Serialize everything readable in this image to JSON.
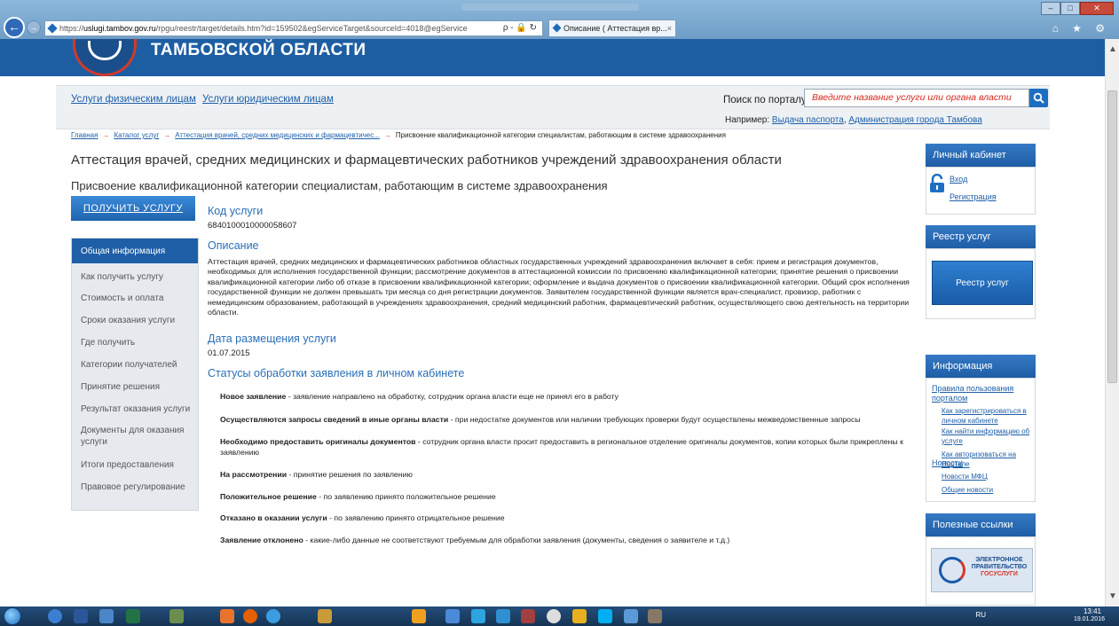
{
  "browser": {
    "address_scheme": "https://",
    "address_host": "uslugi.tambov.gov.ru",
    "address_path": "/rpgu/reestr/target/details.htm?id=159502&egServiceTarget&sourceId=4018@egService",
    "address_icons": "ρ - 🔒 ↻",
    "tab_title": "Описание ( Аттестация вр...",
    "tab_close": "×",
    "chrome_icons": "⌂ ★ ⚙"
  },
  "header": {
    "title": "ТАМБОВСКОЙ ОБЛАСТИ"
  },
  "topnav": {
    "individuals": "Услуги физическим лицам",
    "legal": "Услуги юридическим лицам",
    "search_label": "Поиск по порталу:",
    "search_placeholder": "Введите название услуги или органа власти",
    "example_prefix": "Например:",
    "example_link1": "Выдача паспорта",
    "example_sep": ",",
    "example_link2": "Администрация города Тамбова"
  },
  "breadcrumb": {
    "items": [
      "Главная",
      "Каталог услуг",
      "Аттестация врачей, средних медицинских и фармацевтичес..."
    ],
    "current": "Присвоение квалификационной категории специалистам, работающим в системе здравоохранения",
    "sep": "→"
  },
  "page": {
    "title": "Аттестация врачей, средних медицинских и фармацевтических работников учреждений здравоохранения области",
    "subtitle": "Присвоение квалификационной категории специалистам, работающим в системе здравоохранения",
    "get_service": "ПОЛУЧИТЬ УСЛУГУ"
  },
  "leftnav": {
    "active": "Общая информация",
    "items": [
      "Как получить услугу",
      "Стоимость и оплата",
      "Сроки оказания услуги",
      "Где получить",
      "Категории получателей",
      "Принятие решения",
      "Результат оказания услуги",
      "Документы для оказания услуги",
      "Итоги предоставления",
      "Правовое регулирование"
    ]
  },
  "main": {
    "code_head": "Код услуги",
    "code_value": "6840100010000058607",
    "desc_head": "Описание",
    "desc_text": "Аттестация врачей, средних медицинских и фармацевтических работников областных государственных  учреждений здравоохранения включает в себя: прием и регистрация документов, необходимых для исполнения государственной функции; рассмотрение документов в аттестационной комиссии по присвоению квалификационной категории; принятие решения о присвоении квалификационной категории либо об отказе в присвоении квалификационной категории; оформление и выдача документов о присвоении квалификационной категории. Общий срок исполнения государственной функции не должен превышать три месяца со дня регистрации документов. Заявителем государственной функции является врач-специалист,  провизор, работник с немедицинским образованием, работающий в  учреждениях здравоохранения, средний медицинский работник, фармацевтический работник, осуществляющего свою деятельность на территории области.",
    "date_head": "Дата размещения услуги",
    "date_value": "01.07.2015",
    "status_head": "Статусы обработки заявления в личном кабинете",
    "statuses": [
      {
        "name": "Новое заявление",
        "text": " - заявление направлено на обработку, сотрудник органа власти еще не принял его в работу"
      },
      {
        "name": "Осуществляются запросы сведений в иные органы власти",
        "text": " - при недостатке документов или наличии требующих проверки будут осуществлены межведомственные запросы"
      },
      {
        "name": "Необходимо предоставить оригиналы документов",
        "text": " - сотрудник органа власти просит предоставить в региональное отделение оригиналы документов, копии которых были прикреплены к заявлению"
      },
      {
        "name": "На рассмотрении",
        "text": " - принятие решения по заявлению"
      },
      {
        "name": "Положительное решение",
        "text": " - по заявлению принято положительное решение"
      },
      {
        "name": "Отказано в оказании услуги",
        "text": " - по заявлению принято отрицательное решение"
      },
      {
        "name": "Заявление отклонено",
        "text": " - какие-либо данные не соответствуют требуемым для обработки заявления (документы, сведения о заявителе и т.д.)"
      }
    ]
  },
  "right": {
    "cabinet_head": "Личный кабинет",
    "login": "Вход",
    "register": "Регистрация",
    "registry_head": "Реестр услуг",
    "registry_btn": "Реестр услуг",
    "info_head": "Информация",
    "rules": "Правила пользования порталом",
    "rules_sub": [
      "Как зарегистрироваться в личном кабинете",
      "Как найти информацию об услуге",
      "Как авторизоваться на Портале"
    ],
    "news": "Новости",
    "news_sub": [
      "Новости МФЦ",
      "Общие новости"
    ],
    "links_head": "Полезные ссылки",
    "gos_title": "ЭЛЕКТРОННОЕ ПРАВИТЕЛЬСТВО",
    "gos_sub": "ГОСУСЛУГИ"
  },
  "taskbar": {
    "lang": "RU",
    "time": "13:41",
    "date": "19.01.2016"
  }
}
